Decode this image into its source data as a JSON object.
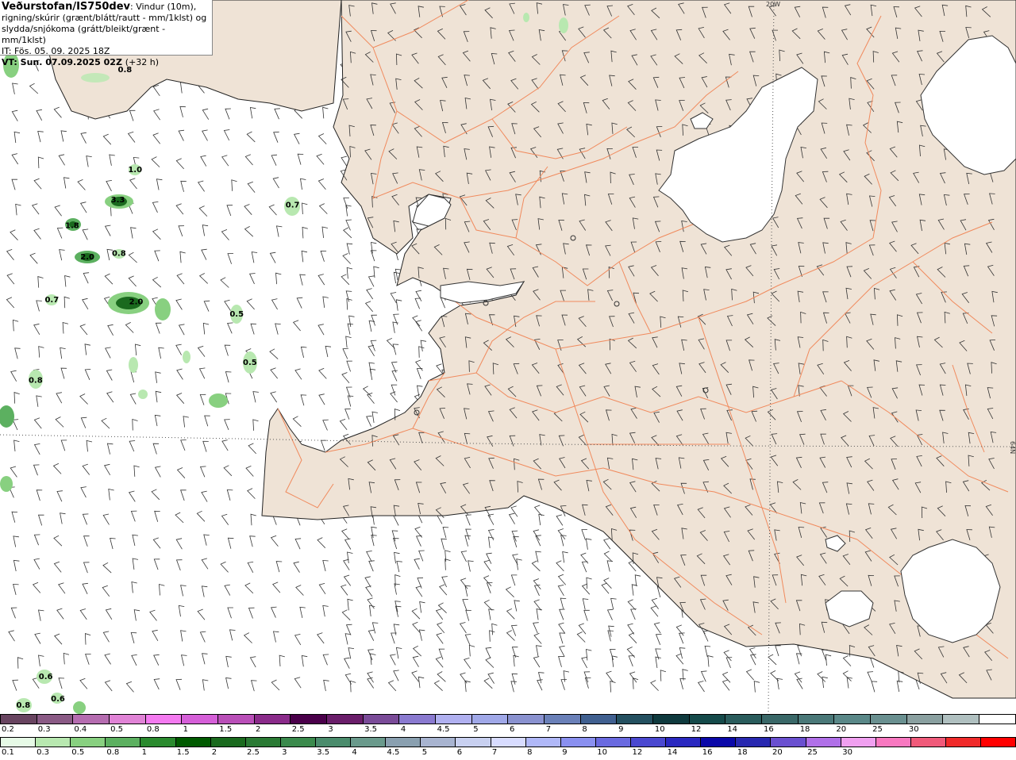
{
  "header": {
    "title": "Veðurstofan/IS750dev",
    "desc1": ": Vindur (10m),",
    "desc2": "rigning/skúrir (grænt/blátt/rautt - mm/1klst) og",
    "desc3": "slydda/snjókoma (grátt/bleikt/grænt - mm/1klst)",
    "it": "IT: Fös. 05. 09. 2025 18Z",
    "vt_label": "VT: Sun. 07.09.2025 02Z",
    "vt_offset": "(+32 h)"
  },
  "map": {
    "grid_labels": {
      "longitude": "20W",
      "latitude": "64N"
    },
    "colors": {
      "land": "#efe3d6",
      "ocean": "#ffffff",
      "glacier": "#ffffff",
      "roads": "#f08a5d",
      "coast": "#333333",
      "wind_barbs": "#333333"
    },
    "precip_labels": [
      {
        "text": "0.8",
        "lon_pct": 12.3,
        "lat_pct": 9.8
      },
      {
        "text": "1.0",
        "lon_pct": 13.3,
        "lat_pct": 23.8
      },
      {
        "text": "3.3",
        "lon_pct": 11.6,
        "lat_pct": 28.0
      },
      {
        "text": "0.7",
        "lon_pct": 28.8,
        "lat_pct": 28.7
      },
      {
        "text": "1.8",
        "lon_pct": 7.1,
        "lat_pct": 31.6
      },
      {
        "text": "2.0",
        "lon_pct": 8.6,
        "lat_pct": 36.0
      },
      {
        "text": "0.8",
        "lon_pct": 11.7,
        "lat_pct": 35.5
      },
      {
        "text": "0.7",
        "lon_pct": 5.1,
        "lat_pct": 42.0
      },
      {
        "text": "2.0",
        "lon_pct": 13.4,
        "lat_pct": 42.3
      },
      {
        "text": "0.5",
        "lon_pct": 23.3,
        "lat_pct": 44.0
      },
      {
        "text": "0.5",
        "lon_pct": 24.6,
        "lat_pct": 50.8
      },
      {
        "text": "0.8",
        "lon_pct": 3.5,
        "lat_pct": 53.3
      },
      {
        "text": "0.6",
        "lon_pct": 4.5,
        "lat_pct": 94.8
      },
      {
        "text": "0.6",
        "lon_pct": 5.7,
        "lat_pct": 97.9
      },
      {
        "text": "0.8",
        "lon_pct": 2.3,
        "lat_pct": 98.8
      }
    ]
  },
  "legend_snow": {
    "colors": [
      "#684460",
      "#8a5a85",
      "#b56cb0",
      "#e083d6",
      "#f47af0",
      "#d55fd8",
      "#b94fb8",
      "#8a2b8a",
      "#4a004a",
      "#6a1e6a",
      "#7a4b98",
      "#8a7ad0",
      "#b0b0f0",
      "#a0a8e8",
      "#8a92d0",
      "#6a80b8",
      "#406090",
      "#245060",
      "#0f3a3e",
      "#154a4a",
      "#2a5c5c",
      "#3a6868",
      "#4a7878",
      "#5a8888",
      "#6a9090",
      "#8aa0a0",
      "#b0c0c0",
      "#ffffff"
    ],
    "ticks": [
      "0.2",
      "0.3",
      "0.4",
      "0.5",
      "0.8",
      "1",
      "1.5",
      "2",
      "2.5",
      "3",
      "3.5",
      "4",
      "4.5",
      "5",
      "6",
      "7",
      "8",
      "9",
      "10",
      "12",
      "14",
      "16",
      "18",
      "20",
      "25",
      "30"
    ]
  },
  "legend_rain": {
    "colors": [
      "#e6fae6",
      "#b8e8b0",
      "#88d080",
      "#5cb060",
      "#2a8a2e",
      "#005a00",
      "#1a6a1e",
      "#2a7a34",
      "#3a8a4c",
      "#4a8c6c",
      "#6a9a8c",
      "#8aa0b0",
      "#a8b4d0",
      "#c8d0f0",
      "#d8dcff",
      "#b0b8f8",
      "#8a90f0",
      "#6a6ae0",
      "#4a48d0",
      "#2a28c0",
      "#0a08a8",
      "#2828b0",
      "#6a50d0",
      "#b070e8",
      "#f0a0f0",
      "#f878c0",
      "#f05a7a",
      "#f02a2a",
      "#ff0000"
    ],
    "ticks": [
      "0.1",
      "0.3",
      "0.5",
      "0.8",
      "1",
      "1.5",
      "2",
      "2.5",
      "3",
      "3.5",
      "4",
      "4.5",
      "5",
      "6",
      "7",
      "8",
      "9",
      "10",
      "12",
      "14",
      "16",
      "18",
      "20",
      "25",
      "30"
    ]
  }
}
